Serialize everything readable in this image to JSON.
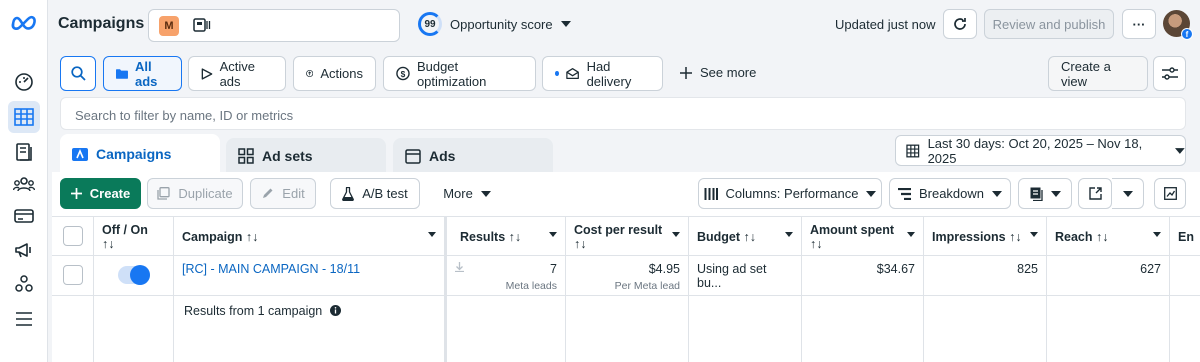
{
  "app": {
    "title": "Campaigns"
  },
  "account": {
    "initial": "M"
  },
  "opportunity": {
    "score": "99",
    "label": "Opportunity score"
  },
  "status": {
    "updated": "Updated just now"
  },
  "actions": {
    "review_publish": "Review and publish",
    "more": "···"
  },
  "filters": {
    "all_ads": "All ads",
    "active_ads": "Active ads",
    "actions": "Actions",
    "budget_optimization": "Budget optimization",
    "had_delivery": "Had delivery",
    "see_more": "See more",
    "create_view": "Create a view"
  },
  "search": {
    "placeholder": "Search to filter by name, ID or metrics"
  },
  "tabs": [
    {
      "label": "Campaigns"
    },
    {
      "label": "Ad sets"
    },
    {
      "label": "Ads"
    }
  ],
  "date_range": "Last 30 days: Oct 20, 2025 – Nov 18, 2025",
  "toolbar": {
    "create": "Create",
    "duplicate": "Duplicate",
    "edit": "Edit",
    "ab_test": "A/B test",
    "more": "More",
    "columns": "Columns: Performance",
    "breakdown": "Breakdown"
  },
  "table": {
    "headers": {
      "off_on": "Off / On",
      "sort": "↑↓",
      "campaign": "Campaign ↑↓",
      "results": "Results ↑↓",
      "cost_per_result": "Cost per result",
      "budget": "Budget ↑↓",
      "amount_spent": "Amount spent",
      "impressions": "Impressions ↑↓",
      "reach": "Reach ↑↓",
      "ends": "En"
    },
    "row": {
      "campaign": "[RC] - MAIN CAMPAIGN - 18/11",
      "results": "7",
      "results_sub": "Meta leads",
      "cost": "$4.95",
      "cost_sub": "Per Meta lead",
      "budget": "Using ad set bu...",
      "amount_spent": "$34.67",
      "impressions": "825",
      "reach": "627"
    },
    "summary": "Results from 1 campaign"
  },
  "colors": {
    "accent": "#1877f2",
    "create": "#0a7a5a"
  }
}
